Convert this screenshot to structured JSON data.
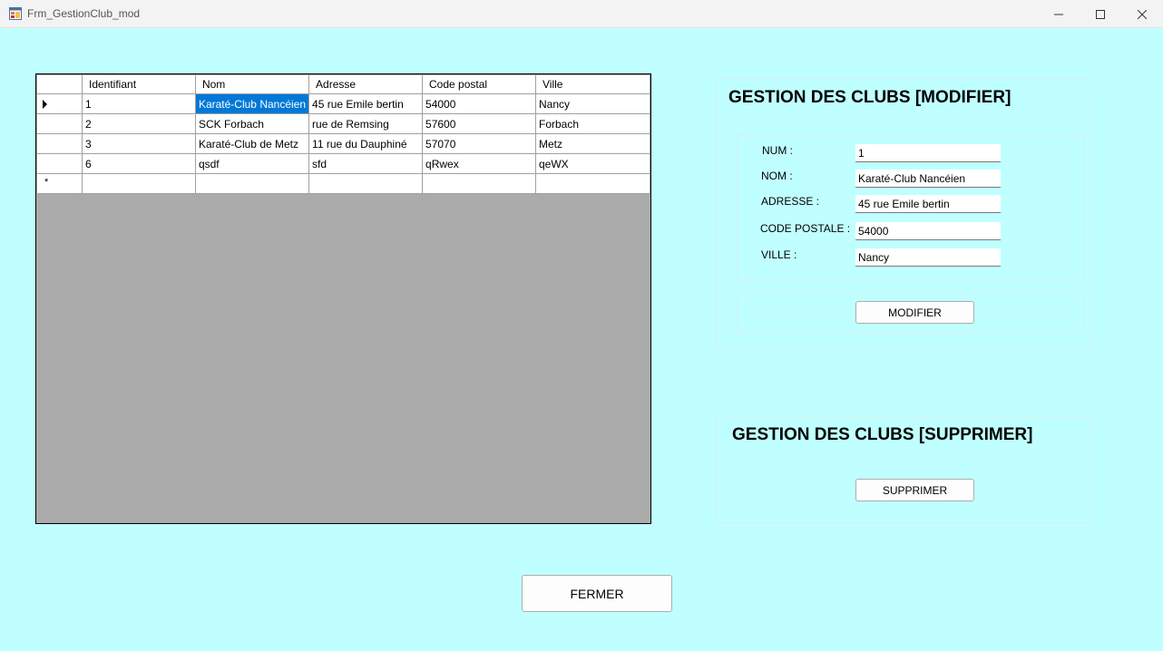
{
  "window": {
    "title": "Frm_GestionClub_mod"
  },
  "grid": {
    "columns": [
      "Identifiant",
      "Nom",
      "Adresse",
      "Code postal",
      "Ville"
    ],
    "rows": [
      [
        "1",
        "Karaté-Club Nancéien",
        "45 rue Emile bertin",
        "54000",
        "Nancy"
      ],
      [
        "2",
        "SCK Forbach",
        "rue de Remsing",
        "57600",
        "Forbach"
      ],
      [
        "3",
        "Karaté-Club de Metz",
        "11 rue du Dauphiné",
        "57070",
        "Metz"
      ],
      [
        "6",
        "qsdf",
        "sfd",
        "qRwex",
        "qeWX"
      ]
    ]
  },
  "modifier": {
    "title": "GESTION DES CLUBS [MODIFIER]",
    "num_label": "NUM :",
    "num_value": "1",
    "nom_label": "NOM :",
    "nom_value": "Karaté-Club Nancéien",
    "adresse_label": "ADRESSE  :",
    "adresse_value": "45 rue Emile bertin",
    "cp_label": "CODE POSTALE :",
    "cp_value": "54000",
    "ville_label": "VILLE :",
    "ville_value": "Nancy",
    "button": "MODIFIER"
  },
  "supprimer": {
    "title": "GESTION DES CLUBS [SUPPRIMER]",
    "button": "SUPPRIMER"
  },
  "fermer_button": "FERMER",
  "colors": {
    "form_bg": "#c0ffff",
    "selection": "#0078d7",
    "grid_bg": "#ababab"
  }
}
